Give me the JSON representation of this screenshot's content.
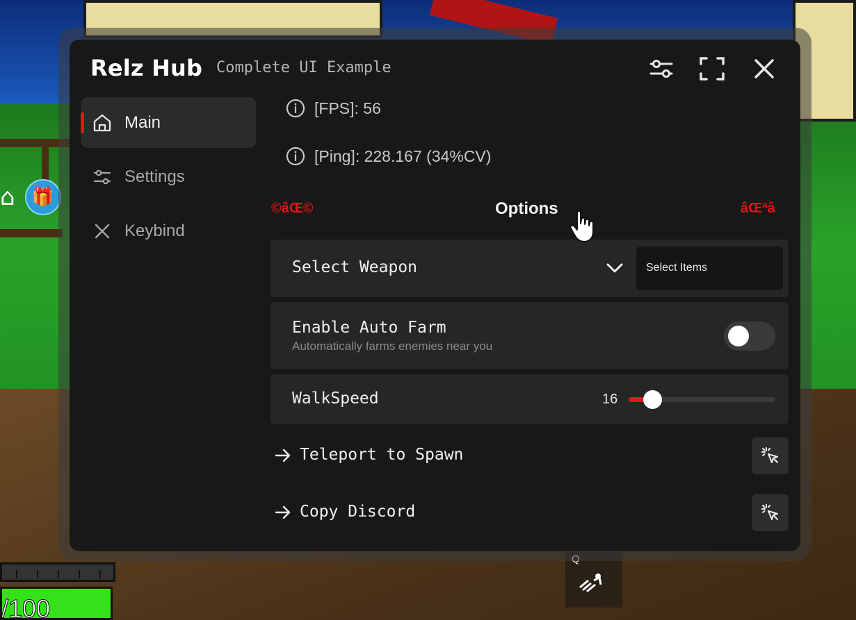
{
  "window": {
    "title": "Relz Hub",
    "subtitle": "Complete UI Example"
  },
  "header_buttons": [
    {
      "name": "sliders-icon"
    },
    {
      "name": "fullscreen-icon"
    },
    {
      "name": "close-icon"
    }
  ],
  "sidebar": {
    "items": [
      {
        "label": "Main",
        "icon": "home-icon",
        "active": true
      },
      {
        "label": "Settings",
        "icon": "sliders-icon",
        "active": false
      },
      {
        "label": "Keybind",
        "icon": "x-icon",
        "active": false
      }
    ]
  },
  "info": {
    "fps": "[FPS]: 56",
    "ping": "[Ping]: 228.167 (34%CV)"
  },
  "section": {
    "title": "Options",
    "garble_left": "©âŒ©",
    "garble_right": "âŒªâ"
  },
  "dropdown": {
    "label": "Select Weapon",
    "value": "Select Items"
  },
  "toggle": {
    "label": "Enable Auto Farm",
    "description": "Automatically farms enemies near you",
    "enabled": false
  },
  "slider": {
    "label": "WalkSpeed",
    "value": "16",
    "fraction": 0.16
  },
  "buttons": [
    {
      "label": "Teleport to Spawn"
    },
    {
      "label": "Copy Discord"
    }
  ],
  "game_hud": {
    "hp_text": "/100",
    "skill_key": "Q"
  },
  "colors": {
    "accent": "#e21515",
    "panel": "#181818",
    "card": "#262626"
  }
}
